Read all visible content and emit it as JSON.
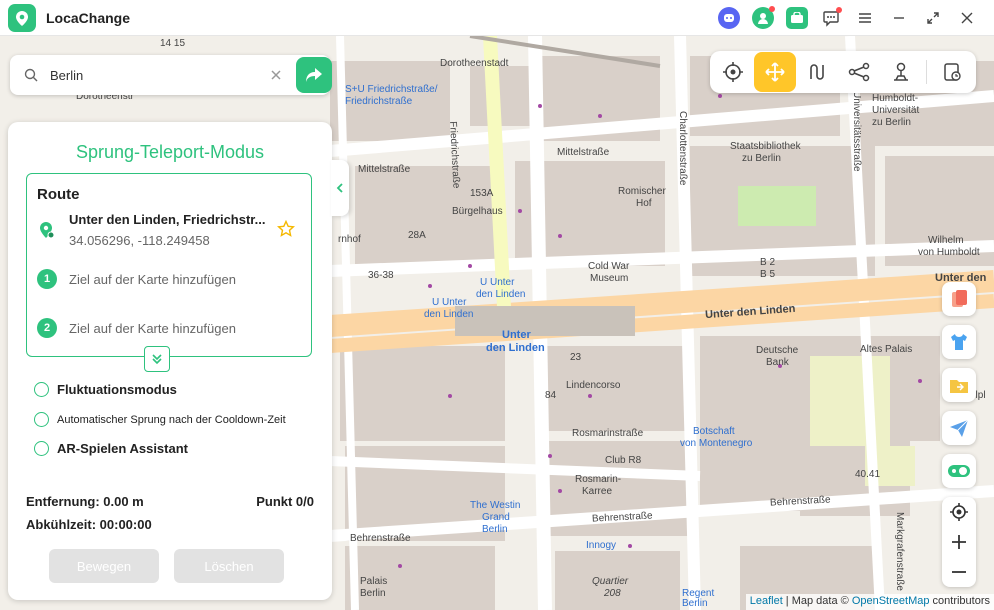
{
  "app": {
    "title": "LocaChange"
  },
  "search": {
    "value": "Berlin",
    "placeholder": ""
  },
  "modes": [
    {
      "name": "current-location-mode-button",
      "icon": "crosshair-icon"
    },
    {
      "name": "jump-teleport-mode-button",
      "icon": "move-arrows-icon",
      "active": true
    },
    {
      "name": "two-spot-mode-button",
      "icon": "route-icon"
    },
    {
      "name": "multi-spot-mode-button",
      "icon": "nodes-icon"
    },
    {
      "name": "joystick-mode-button",
      "icon": "joystick-icon"
    },
    {
      "name": "history-button",
      "icon": "history-icon"
    }
  ],
  "panel": {
    "title": "Sprung-Teleport-Modus",
    "route": {
      "header": "Route",
      "start_name": "Unter den Linden, Friedrichstr...",
      "start_coords": "34.056296, -118.249458",
      "waypoints": [
        {
          "num": "1",
          "text": "Ziel auf der Karte hinzufügen"
        },
        {
          "num": "2",
          "text": "Ziel auf der Karte hinzufügen"
        }
      ]
    },
    "options": {
      "fluctuation": "Fluktuationsmodus",
      "auto_jump": "Automatischer Sprung nach der Cooldown-Zeit",
      "ar_assistant": "AR-Spielen Assistant"
    },
    "stats": {
      "distance": "Entfernung: 0.00 m",
      "points": "Punkt 0/0",
      "cooldown": "Abkühlzeit: 00:00:00"
    },
    "buttons": {
      "move": "Bewegen",
      "delete": "Löschen"
    }
  },
  "map_labels": {
    "dorotheenstadt": "Dorotheenstadt",
    "station_fs": "S+U Friedrichstraße/",
    "station_fs2": "Friedrichstraße",
    "friedrichstrasse_v": "Friedrichstraße",
    "charlottenstrasse": "Charlottenstraße",
    "universitaetsstrasse": "Universitätsstraße",
    "humboldt1": "Humboldt-",
    "humboldt2": "Universität",
    "humboldt3": "zu Berlin",
    "mittelstrasse1": "Mittelstraße",
    "mittelstrasse2": "Mittelstraße",
    "staatsbib1": "Staatsbibliothek",
    "staatsbib2": "zu Berlin",
    "romischer1": "Romischer",
    "romischer2": "Hof",
    "burgelhaus": "Bürgelhaus",
    "wilhelm1": "Wilhelm",
    "wilhelm2": "von Humboldt",
    "cold_war1": "Cold War",
    "cold_war2": "Museum",
    "uudl1": "U Unter",
    "uudl2": "den Linden",
    "uudl3": "U Unter",
    "uudl4": "den Linden",
    "unter_den_linden": "Unter den Linden",
    "unter_bold1": "Unter",
    "unter_bold2": "den Linden",
    "deutsche1": "Deutsche",
    "deutsche2": "Bank",
    "altes_palais": "Altes Palais",
    "lindencorso": "Lindencorso",
    "rosmarinstrasse": "Rosmarinstraße",
    "botschaft1": "Botschaft",
    "botschaft2": "von Montenegro",
    "club": "Club R8",
    "rosmarin1": "Rosmarin-",
    "rosmarin2": "Karree",
    "westin1": "The Westin",
    "westin2": "Grand",
    "westin3": "Berlin",
    "behrenstrasse1": "Behrenstraße",
    "behrenstrasse2": "Behrenstraße",
    "behrenstrasse3": "Behrenstraße",
    "innogy": "Innogy",
    "quartier1": "Quartier",
    "quartier2": "208",
    "palais1": "Palais",
    "palais2": "Berlin",
    "markgrafen": "Markgrafenstraße",
    "regent1": "Regent",
    "regent2": "Berlin",
    "b2": "B 2",
    "b5": "B 5",
    "unter_right": "Unter den",
    "dorotheenstr_left": "Dorotheenstr",
    "ohnhof": "rnhof",
    "selpl": "selpl",
    "n_153a": "153A",
    "n_28a": "28A",
    "n_3638": "36-38",
    "n_84": "84",
    "n_23": "23",
    "n_4041": "40.41",
    "n_1415": "14 15"
  },
  "attribution": {
    "leaflet": "Leaflet",
    "mapdata": " | Map data © ",
    "osm": "OpenStreetMap",
    "contrib": " contributors"
  },
  "colors": {
    "accent": "#2ec27e",
    "active_mode": "#ffc629",
    "route_road": "#fcd6a4",
    "map_bg": "#f2efe9"
  }
}
